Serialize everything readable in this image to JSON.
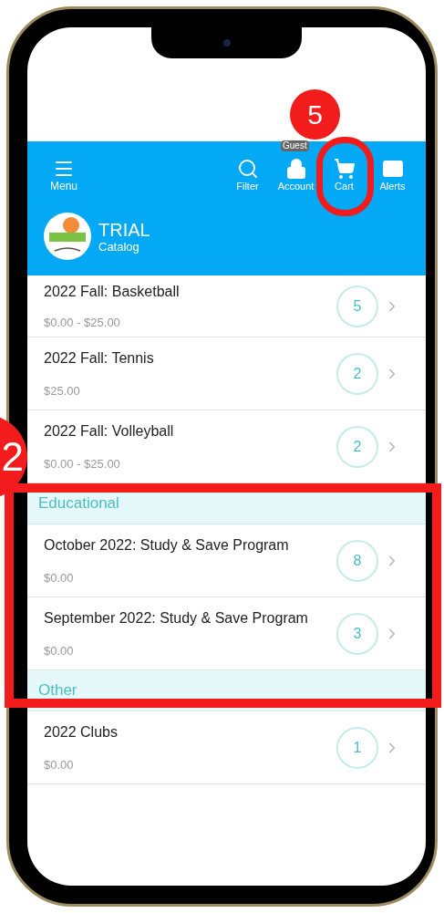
{
  "header": {
    "menu": {
      "label": "Menu"
    },
    "actions": [
      {
        "kind": "filter",
        "label": "Filter"
      },
      {
        "kind": "account",
        "label": "Account",
        "tooltip": "Guest"
      },
      {
        "kind": "cart",
        "label": "Cart"
      },
      {
        "kind": "alerts",
        "label": "Alerts"
      }
    ],
    "brand": {
      "title": "TRIAL",
      "subtitle": "Catalog"
    }
  },
  "groups": [
    {
      "items": [
        {
          "title": "2022 Fall: Basketball",
          "price": "$0.00 - $25.00",
          "count": "5"
        },
        {
          "title": "2022 Fall: Tennis",
          "price": "$25.00",
          "count": "2"
        },
        {
          "title": "2022 Fall: Volleyball",
          "price": "$0.00 - $25.00",
          "count": "2"
        }
      ]
    },
    {
      "header": "Educational",
      "items": [
        {
          "title": "October 2022: Study & Save Program",
          "price": "$0.00",
          "count": "8"
        },
        {
          "title": "September 2022: Study & Save Program",
          "price": "$0.00",
          "count": "3"
        }
      ]
    },
    {
      "header": "Other",
      "items": [
        {
          "title": "2022 Clubs",
          "price": "$0.00",
          "count": "1"
        }
      ]
    }
  ],
  "callouts": [
    {
      "number": "5"
    },
    {
      "number": "2"
    }
  ]
}
